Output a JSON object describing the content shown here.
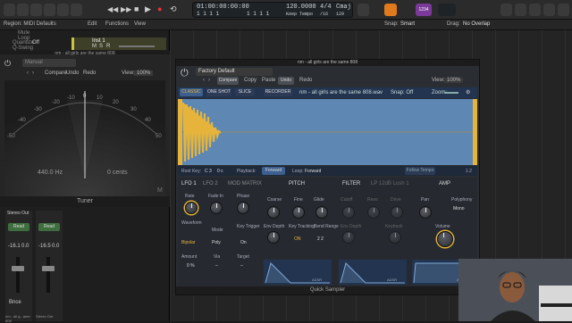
{
  "transport": {
    "position": "01:00:00:00:00",
    "bars": "1 1 1 1",
    "bars2": "1 1 1 1",
    "tempo": "120.0000",
    "tempo_mode": "Keep Tempo",
    "sig": "4/4",
    "sig_div": "/16",
    "key": "Cmaj",
    "key_num": "129",
    "cpu": "1234"
  },
  "menu": {
    "edit": "Edit",
    "functions": "Functions",
    "view": "View"
  },
  "toolbar2": {
    "snap_label": "Snap:",
    "snap_value": "Smart",
    "drag_label": "Drag:",
    "drag_value": "No Overlap"
  },
  "region": {
    "label": "Region: MIDI Defaults",
    "mute": "Mute",
    "loop": "Loop",
    "quantize": "Quantize",
    "quantize_val": "Off",
    "qswing": "Q-Swing"
  },
  "track": {
    "name": "Inst 1",
    "m": "M",
    "s": "S",
    "r": "R"
  },
  "track_header": {
    "name": "nm - all girls are the same 808"
  },
  "tuner": {
    "preset": "Manual",
    "compare": "Compare",
    "undo": "Undo",
    "redo": "Redo",
    "view": "View:",
    "zoom": "100%",
    "freq": "440.0 Hz",
    "cents": "0 cents",
    "m": "M",
    "title": "Tuner",
    "scale": [
      "-50",
      "-40",
      "-30",
      "-20",
      "-10",
      "0",
      "10",
      "20",
      "30",
      "40",
      "50"
    ]
  },
  "channels": [
    {
      "io": "Stereo Out",
      "read": "Read",
      "vol": "-16.1",
      "pan": "0.0",
      "name": "nm - all g...ame 808",
      "btn": "Bnce"
    },
    {
      "io": "",
      "read": "Read",
      "vol": "-16.5",
      "pan": "0.0",
      "name": "Stereo Out",
      "btn": ""
    }
  ],
  "plugin": {
    "title": "nm - all girls are the same 808",
    "preset": "Factory Default",
    "compare": "Compare",
    "copy": "Copy",
    "paste": "Paste",
    "undo": "Undo",
    "redo": "Redo",
    "view": "View:",
    "zoom": "100%",
    "modes": [
      "CLASSIC",
      "ONE SHOT",
      "SLICE"
    ],
    "recorder": "RECORDER",
    "file": "nm - all girls are the same 808.wav",
    "snap": "Snap: Off",
    "zoom_label": "Zoom:",
    "root_key_label": "Root Key:",
    "root_key": "C 3",
    "fine": "0 c",
    "playback_label": "Playback:",
    "playback": "Forward",
    "loop_label": "Loop:",
    "loop": "Forward",
    "follow": "Follow Tempo",
    "follow_val": "1.2",
    "lfo1": "LFO 1",
    "lfo2": "LFO 2",
    "modmatrix": "MOD MATRIX",
    "pitch": "PITCH",
    "filter": "FILTER",
    "lp": "LP 12dB Lush 1",
    "amp": "AMP",
    "lfo_knobs": [
      {
        "label": "Rate",
        "val": ""
      },
      {
        "label": "Fade In",
        "val": ""
      },
      {
        "label": "Phase",
        "val": ""
      }
    ],
    "wave_label": "Waveform",
    "wave": "Bipolar",
    "mode_label": "Mode",
    "mode": "Poly",
    "key_trig_label": "Key Trigger",
    "key_trig": "On",
    "amount": "Amount",
    "amount_val": "0 %",
    "via": "Via",
    "via_val": "–",
    "target": "Target",
    "target_val": "–",
    "pitch_knobs": [
      "Coarse",
      "Fine",
      "Glide"
    ],
    "env_depth": "Env Depth",
    "key_tracking": "Key Tracking",
    "key_tracking_val": "ON",
    "bend": "Bend Range",
    "bend_val": "2 2",
    "filter_knobs": [
      "Cutoff",
      "Reso",
      "Drive"
    ],
    "filter_env": "Env Depth",
    "keytrack": "Keytrack",
    "pan": "Pan",
    "polyphony": "Polyphony",
    "poly_val": "Mono",
    "volume": "Volume",
    "footer": "Quick Sampler",
    "adsr": "ADSR"
  }
}
